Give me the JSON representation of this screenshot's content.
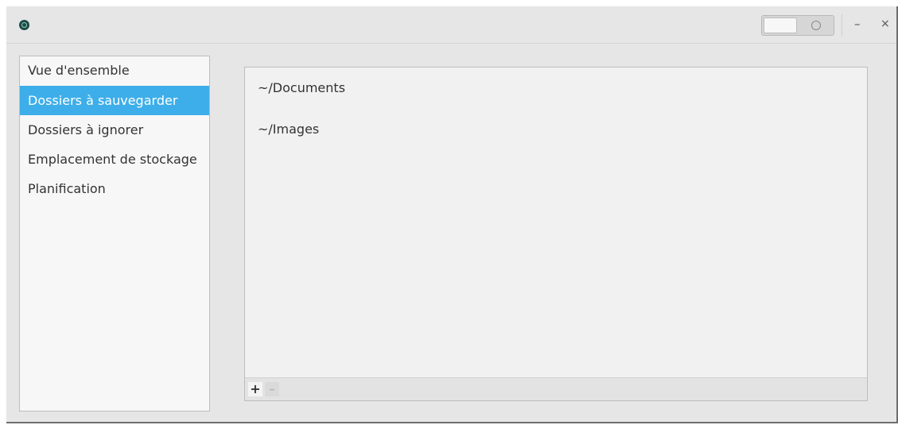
{
  "titlebar": {
    "app_icon": "circle-icon",
    "controls": {
      "minimize_label": "–",
      "close_label": "×",
      "toggle_icon": "circle-off-icon"
    }
  },
  "sidebar": {
    "items": [
      {
        "label": "Vue d'ensemble",
        "selected": false
      },
      {
        "label": "Dossiers à sauvegarder",
        "selected": true
      },
      {
        "label": "Dossiers à ignorer",
        "selected": false
      },
      {
        "label": "Emplacement de stockage",
        "selected": false
      },
      {
        "label": "Planification",
        "selected": false
      }
    ]
  },
  "main": {
    "folders": [
      {
        "path": "~/Documents"
      },
      {
        "path": "~/Images"
      }
    ],
    "toolbar": {
      "add_label": "+",
      "remove_label": "–"
    }
  },
  "colors": {
    "accent": "#3daee9",
    "window_bg": "#e6e6e6",
    "panel_bg": "#f1f1f1"
  }
}
